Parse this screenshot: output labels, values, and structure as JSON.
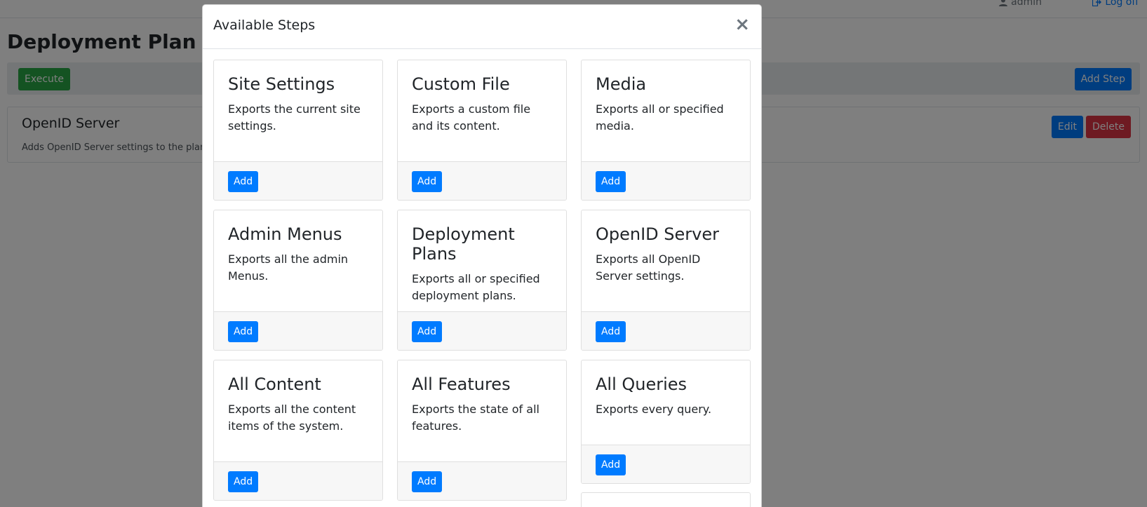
{
  "topbar": {
    "user": "admin",
    "logoff": "Log off"
  },
  "page": {
    "title": "Deployment Plan",
    "execute_label": "Execute",
    "add_step_label": "Add Step"
  },
  "plan_step": {
    "name": "OpenID Server",
    "description": "Adds OpenID Server settings to the plan.",
    "edit_label": "Edit",
    "delete_label": "Delete"
  },
  "modal": {
    "title": "Available Steps",
    "close_label": "×",
    "add_label": "Add",
    "cards": [
      {
        "title": "Site Settings",
        "text": "Exports the current site settings."
      },
      {
        "title": "Custom File",
        "text": "Exports a custom file and its content."
      },
      {
        "title": "Media",
        "text": "Exports all or specified media."
      },
      {
        "title": "Admin Menus",
        "text": "Exports all the admin Menus."
      },
      {
        "title": "Deployment Plans",
        "text": "Exports all or specified deployment plans."
      },
      {
        "title": "OpenID Server",
        "text": "Exports all OpenID Server settings."
      },
      {
        "title": "All Content",
        "text": "Exports all the content items of the system."
      },
      {
        "title": "All Features",
        "text": "Exports the state of all features."
      },
      {
        "title": "All Queries",
        "text": "Exports every query."
      }
    ]
  },
  "colors": {
    "primary": "#007bff",
    "success": "#28a745",
    "danger": "#dc3545"
  }
}
